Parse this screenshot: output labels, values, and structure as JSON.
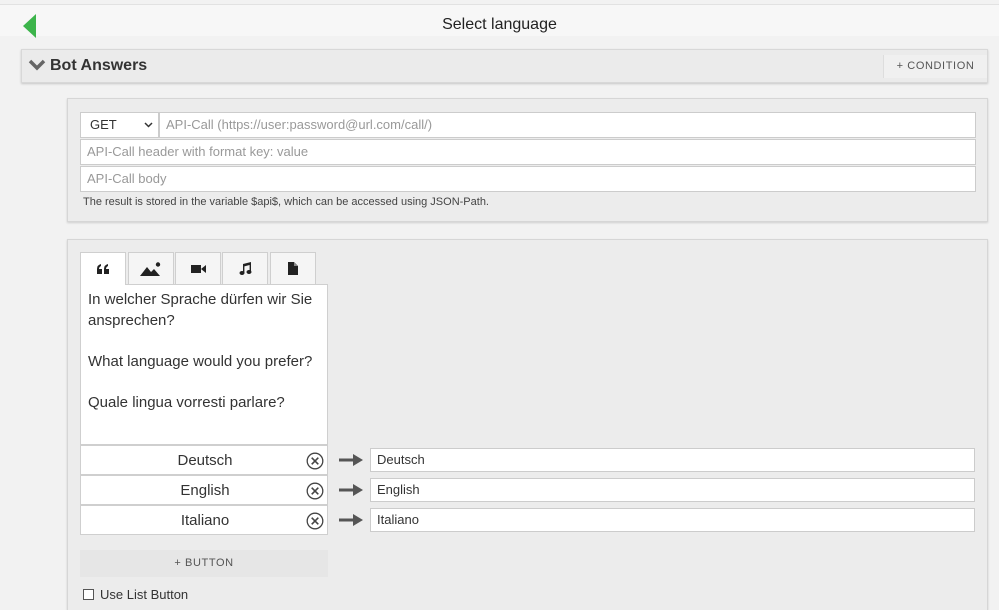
{
  "header": {
    "title": "Select language",
    "back_icon": "back-arrow-icon",
    "accent": "#3cb44b"
  },
  "section": {
    "title": "Bot Answers",
    "condition_label": "+ CONDITION"
  },
  "api": {
    "method": "GET",
    "url_placeholder": "API-Call (https://user:password@url.com/call/)",
    "header_placeholder": "API-Call header with format key: value",
    "body_placeholder": "API-Call body",
    "note": "The result is stored in the variable $api$, which can be accessed using JSON-Path."
  },
  "tabs": [
    {
      "icon": "quote-icon",
      "active": true
    },
    {
      "icon": "image-icon",
      "active": false
    },
    {
      "icon": "video-icon",
      "active": false
    },
    {
      "icon": "music-icon",
      "active": false
    },
    {
      "icon": "file-icon",
      "active": false
    }
  ],
  "message": {
    "lines": [
      "In welcher Sprache dürfen wir Sie",
      "ansprechen?",
      "What language would you prefer?",
      "Quale lingua vorresti parlare?"
    ]
  },
  "buttons": [
    {
      "label": "Deutsch",
      "target": "Deutsch"
    },
    {
      "label": "English",
      "target": "English"
    },
    {
      "label": "Italiano",
      "target": "Italiano"
    }
  ],
  "add_button_label": "+ BUTTON",
  "list_button_label": "Use List Button"
}
